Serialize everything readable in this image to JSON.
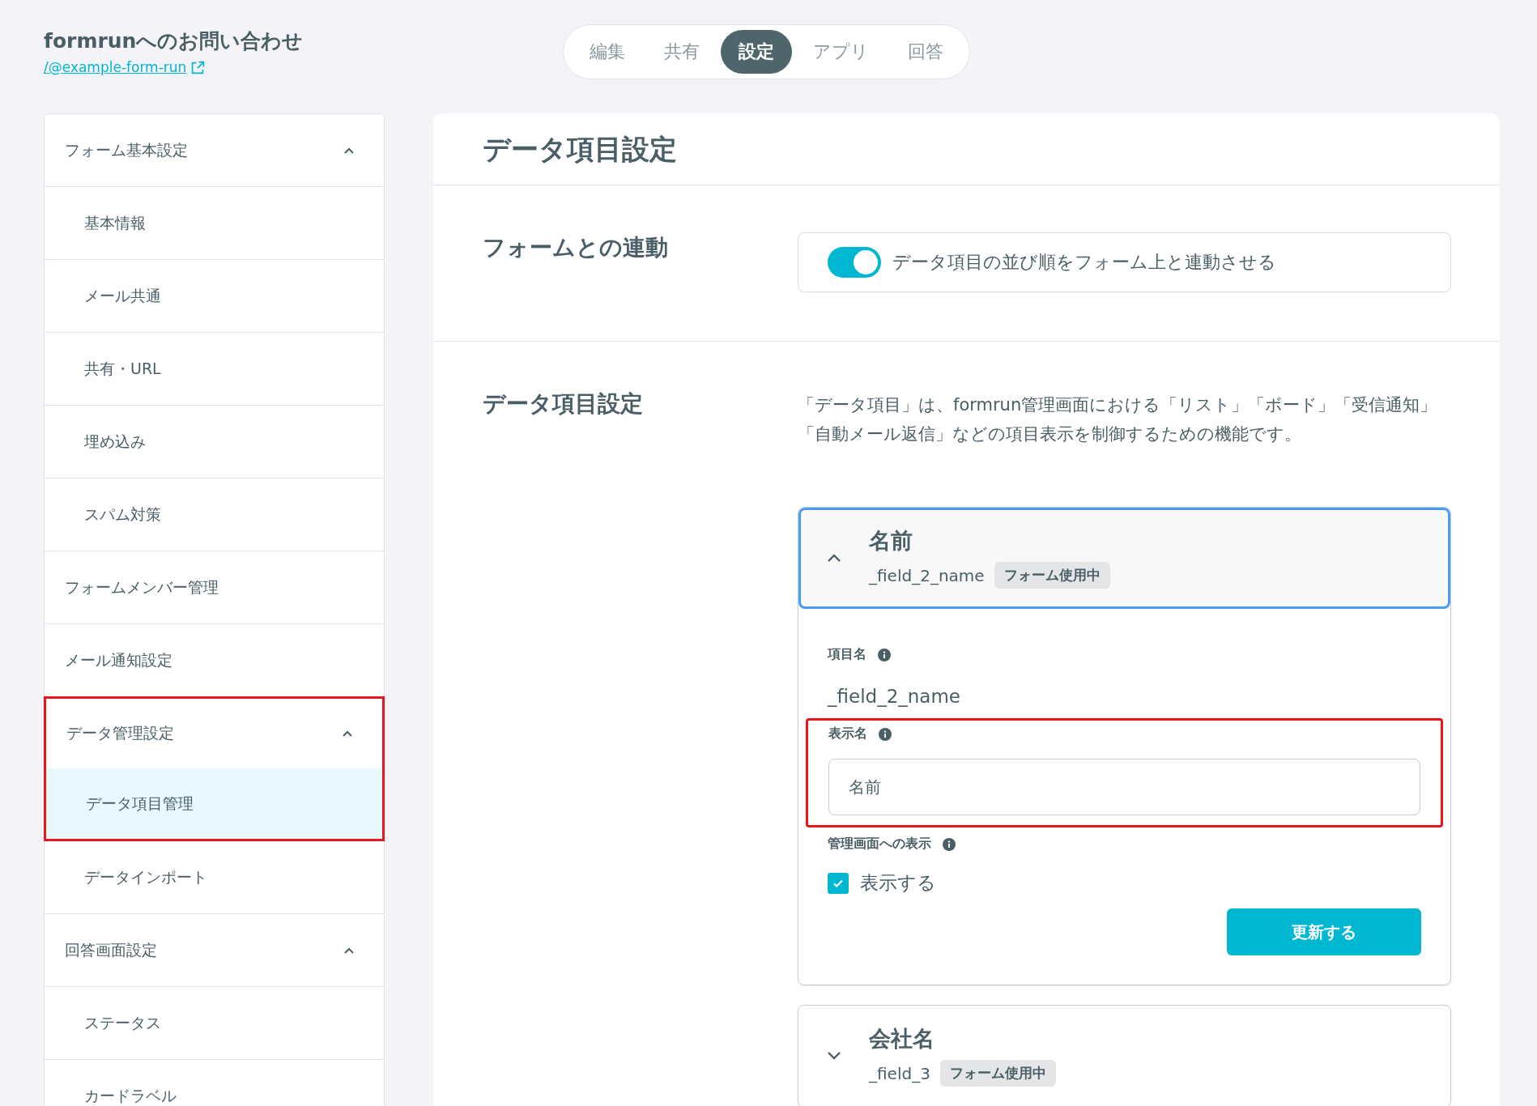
{
  "form": {
    "title": "formrunへのお問い合わせ",
    "link": "/@example-form-run"
  },
  "tabs": [
    {
      "label": "編集",
      "selected": false
    },
    {
      "label": "共有",
      "selected": false
    },
    {
      "label": "設定",
      "selected": true
    },
    {
      "label": "アプリ",
      "selected": false
    },
    {
      "label": "回答",
      "selected": false
    }
  ],
  "sidebar": {
    "groups": [
      {
        "label": "フォーム基本設定",
        "expanded": true,
        "highlighted": false,
        "children": [
          {
            "label": "基本情報",
            "selected": false,
            "highlighted": false
          },
          {
            "label": "メール共通",
            "selected": false,
            "highlighted": false
          },
          {
            "label": "共有・URL",
            "selected": false,
            "highlighted": false
          },
          {
            "label": "埋め込み",
            "selected": false,
            "highlighted": false
          },
          {
            "label": "スパム対策",
            "selected": false,
            "highlighted": false
          }
        ]
      },
      {
        "label": "フォームメンバー管理",
        "highlighted": false
      },
      {
        "label": "メール通知設定",
        "highlighted": false
      },
      {
        "label": "データ管理設定",
        "expanded": true,
        "highlighted": true,
        "children": [
          {
            "label": "データ項目管理",
            "selected": true,
            "highlighted": true
          },
          {
            "label": "データインポート",
            "selected": false,
            "highlighted": false
          }
        ]
      },
      {
        "label": "回答画面設定",
        "expanded": true,
        "highlighted": false,
        "children": [
          {
            "label": "ステータス",
            "selected": false,
            "highlighted": false
          },
          {
            "label": "カードラベル",
            "selected": false,
            "highlighted": false
          }
        ]
      }
    ]
  },
  "main": {
    "title": "データ項目設定",
    "sync": {
      "label": "フォームとの連動",
      "toggle_label": "データ項目の並び順をフォーム上と連動させる",
      "on": true
    },
    "fields_section": {
      "label": "データ項目設定",
      "description": "「データ項目」は、formrun管理画面における「リスト」「ボード」「受信通知」「自動メール返信」などの項目表示を制御するための機能です。",
      "fields": [
        {
          "name": "名前",
          "key": "_field_2_name",
          "badge": "フォーム使用中",
          "expanded": true,
          "item_name_label": "項目名",
          "item_name": "_field_2_name",
          "display_name_label": "表示名",
          "display_name": "名前",
          "display_name_highlighted": true,
          "show_label": "管理画面への表示",
          "show_checkbox_label": "表示する",
          "show_checked": true,
          "submit": "更新する"
        },
        {
          "name": "会社名",
          "key": "_field_3",
          "badge": "フォーム使用中",
          "expanded": false
        }
      ]
    }
  }
}
